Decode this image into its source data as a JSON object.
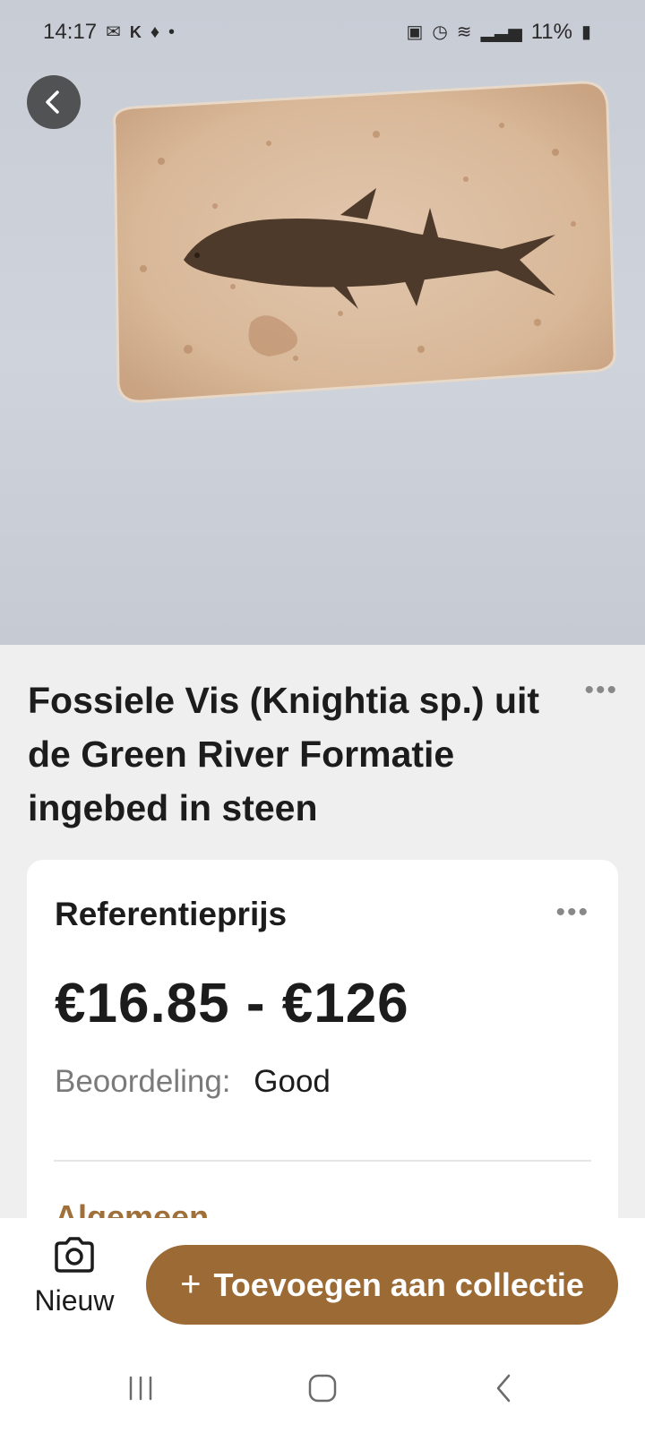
{
  "status_bar": {
    "time": "14:17",
    "left_icons": [
      "gmail-icon",
      "k-icon",
      "fire-icon",
      "dot-icon"
    ],
    "right_icons": [
      "lock-icon",
      "alarm-icon",
      "wifi-icon",
      "signal-icon"
    ],
    "battery_text": "11%"
  },
  "hero": {
    "description": "photo-of-fossil-fish-in-stone"
  },
  "item": {
    "title": "Fossiele Vis (Knightia sp.) uit de Green River Formatie ingebed in steen"
  },
  "price_card": {
    "heading": "Referentieprijs",
    "price_range": "€16.85 - €126",
    "rating_label": "Beoordeling:",
    "rating_value": "Good",
    "next_section_peek": "Algemeen"
  },
  "actions": {
    "new_label": "Nieuw",
    "add_plus": "+",
    "add_label": "Toevoegen aan collectie"
  },
  "colors": {
    "accent": "#9b6a35",
    "background": "#efefef",
    "card": "#ffffff"
  },
  "navbar": {
    "items": [
      "recent-apps-icon",
      "home-icon",
      "back-icon"
    ]
  }
}
